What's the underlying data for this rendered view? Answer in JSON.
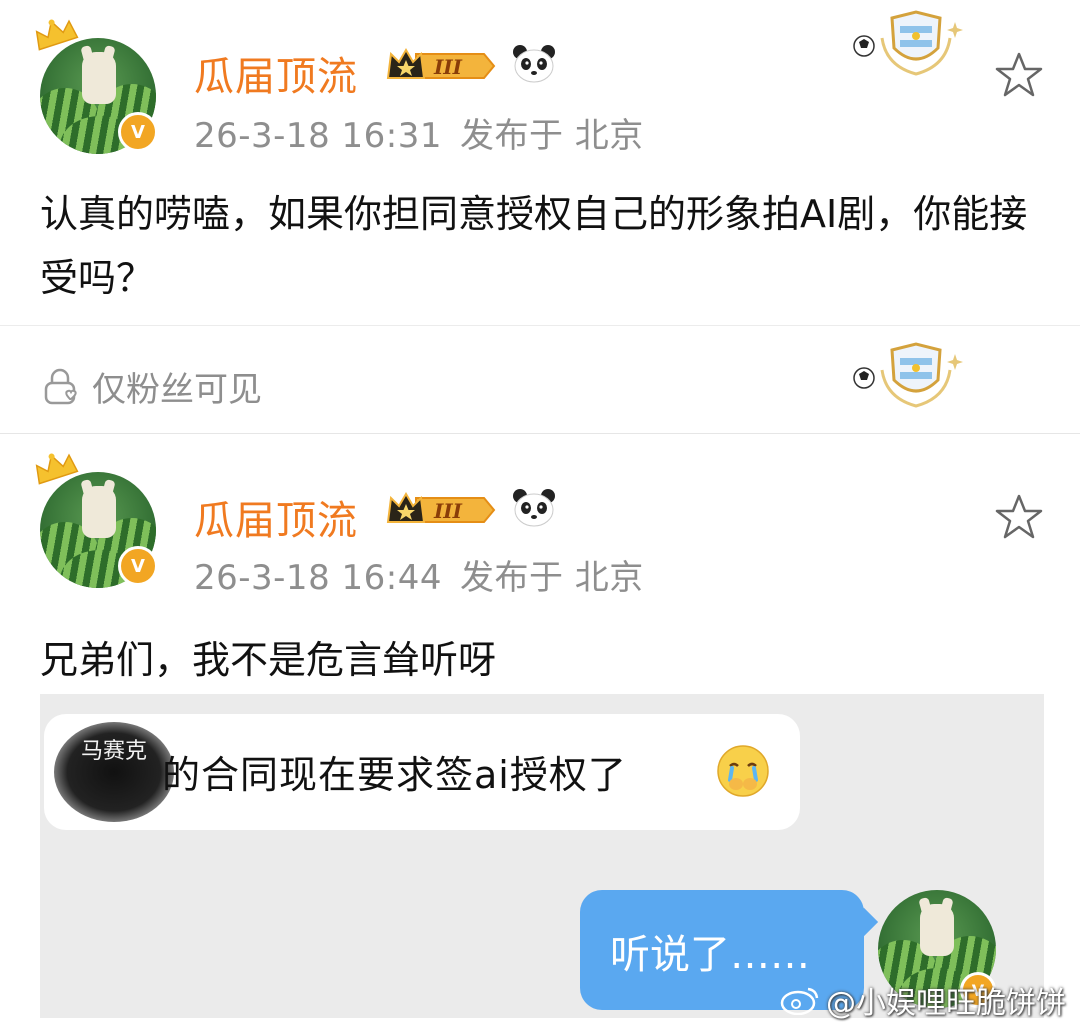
{
  "post1": {
    "username": "瓜届顶流",
    "level": "III",
    "timestamp": "26-3-18 16:31",
    "location": "发布于 北京",
    "text": "认真的唠嗑，如果你担同意授权自己的形象拍AI剧，你能接受吗？"
  },
  "visibility": {
    "label": "仅粉丝可见"
  },
  "post2": {
    "username": "瓜届顶流",
    "level": "III",
    "timestamp": "26-3-18 16:44",
    "location": "发布于 北京",
    "text": "兄弟们，我不是危言耸听呀",
    "chat": {
      "blurred_name": "马赛克",
      "left_message": "的合同现在要求签ai授权了",
      "right_message": "听说了……"
    }
  },
  "watermark": {
    "text": "@小娱哩旺脆饼饼"
  },
  "colors": {
    "username": "#f07a20",
    "meta": "#8e8e8e",
    "chat_bubble_right": "#5aa8f0",
    "chat_background": "#ebebeb"
  },
  "icons": [
    "crown-icon",
    "verified-badge-icon",
    "level-crown-badge",
    "panda-icon",
    "fan-badge-icon",
    "star-icon",
    "lock-icon",
    "crying-emoji-icon",
    "weibo-icon"
  ]
}
